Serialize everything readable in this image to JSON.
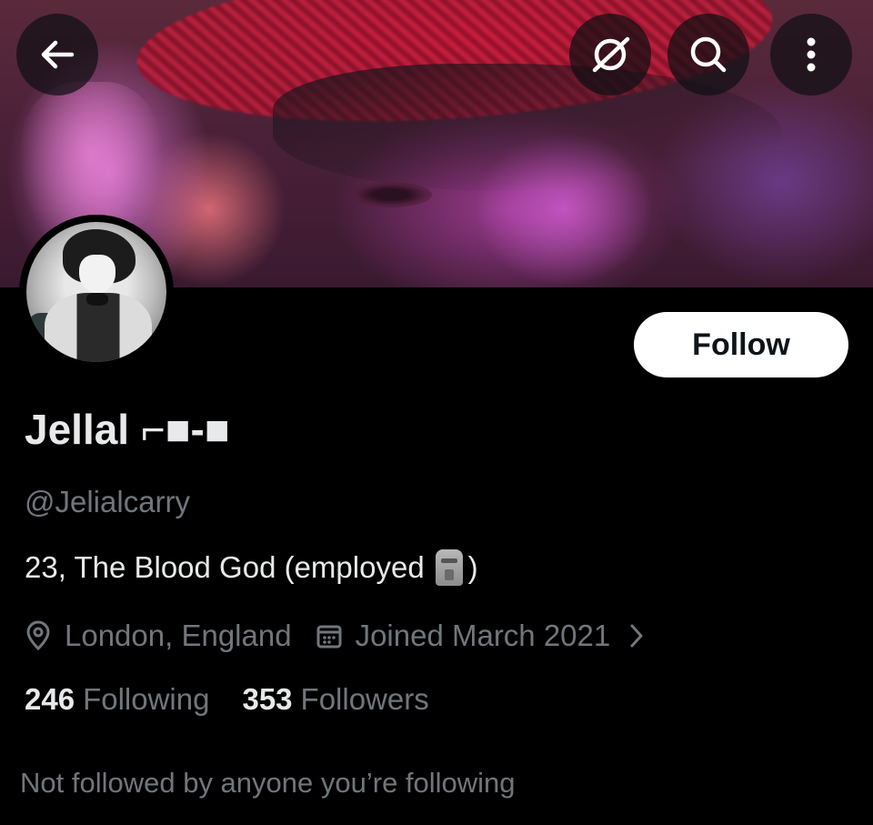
{
  "header": {
    "back_icon": "arrow-left-icon",
    "grok_icon": "grok-icon",
    "search_icon": "search-icon",
    "more_icon": "more-vertical-icon"
  },
  "profile": {
    "display_name": "Jellal ⌐■-■",
    "handle": "@Jelialcarry",
    "bio_text": "23, The Blood God (employed",
    "bio_emoji": "moai-emoji",
    "bio_close": ")",
    "location": "London, England",
    "joined": "Joined March 2021",
    "following_count": "246",
    "following_label": "Following",
    "followers_count": "353",
    "followers_label": "Followers",
    "not_followed_text": "Not followed by anyone you’re following"
  },
  "actions": {
    "follow_label": "Follow"
  },
  "colors": {
    "background": "#000000",
    "primary_text": "#e7e9ea",
    "secondary_text": "#71767b",
    "follow_button_bg": "#ffffff"
  }
}
